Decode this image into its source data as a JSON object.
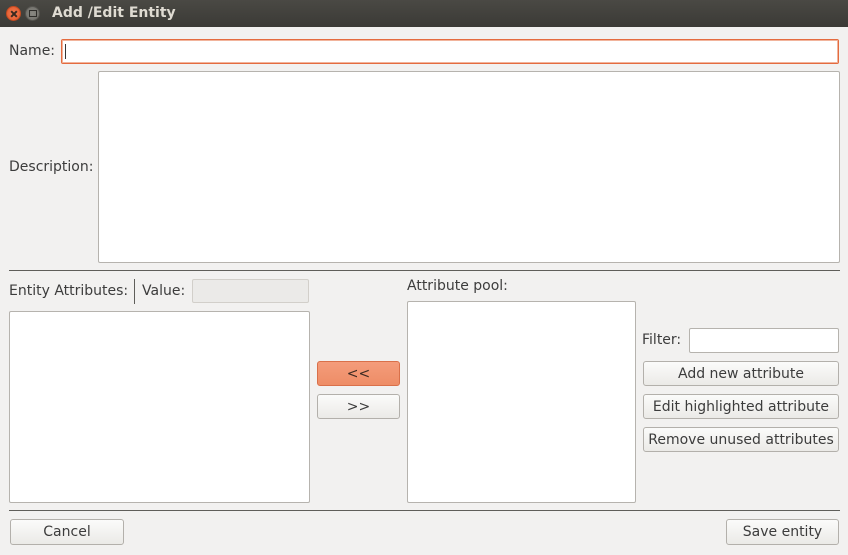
{
  "window": {
    "title": "Add /Edit Entity"
  },
  "form": {
    "name_label": "Name:",
    "name_value": "",
    "description_label": "Description:",
    "description_value": ""
  },
  "attributes": {
    "entity_attributes_label": "Entity Attributes:",
    "value_label": "Value:",
    "value_field": "",
    "attribute_pool_label": "Attribute pool:",
    "move_left_label": "<<",
    "move_right_label": ">>",
    "entity_attributes_list": [],
    "attribute_pool_list": []
  },
  "pool_actions": {
    "filter_label": "Filter:",
    "filter_value": "",
    "add_new_label": "Add new attribute",
    "edit_highlighted_label": "Edit highlighted attribute",
    "remove_unused_label": "Remove unused attributes"
  },
  "footer": {
    "cancel_label": "Cancel",
    "save_label": "Save entity"
  },
  "colors": {
    "accent": "#ee8d66",
    "focus_border": "#e46b3f",
    "titlebar": "#3c3b37"
  }
}
